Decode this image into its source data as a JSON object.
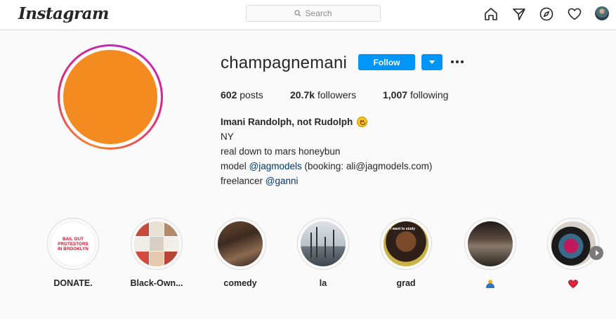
{
  "nav": {
    "logo": "Instagram",
    "search_placeholder": "Search",
    "icons": [
      "home-icon",
      "direct-message-icon",
      "explore-compass-icon",
      "activity-heart-icon",
      "profile-avatar"
    ]
  },
  "profile": {
    "username": "champagnemani",
    "follow_label": "Follow",
    "stats": {
      "posts_count": "602",
      "posts_label": "posts",
      "followers_count": "20.7k",
      "followers_label": "followers",
      "following_count": "1,007",
      "following_label": "following"
    },
    "bio": {
      "name": "Imani Randolph, not Rudolph",
      "location": "NY",
      "line2": "real down to mars honeybun",
      "line3_prefix": "model ",
      "line3_link": "@jagmodels",
      "line3_suffix": " (booking: ali@jagmodels.com)",
      "line4_prefix": "freelancer ",
      "line4_link": "@ganni"
    }
  },
  "highlights": [
    {
      "label": "DONATE.",
      "cover_text": "BAIL OUT PROTESTORS IN BROOKLYN"
    },
    {
      "label": "Black-Own..."
    },
    {
      "label": "comedy"
    },
    {
      "label": "la"
    },
    {
      "label": "grad",
      "cover_text": "i want to study"
    },
    {
      "label": "",
      "emoji": "bust-in-silhouette-emoji"
    },
    {
      "label": "",
      "emoji": "red-heart-emoji"
    }
  ],
  "colors": {
    "accent_blue": "#0095f6",
    "link": "#00376b",
    "avatar_fill": "#f48b20",
    "background": "#fafafa"
  }
}
